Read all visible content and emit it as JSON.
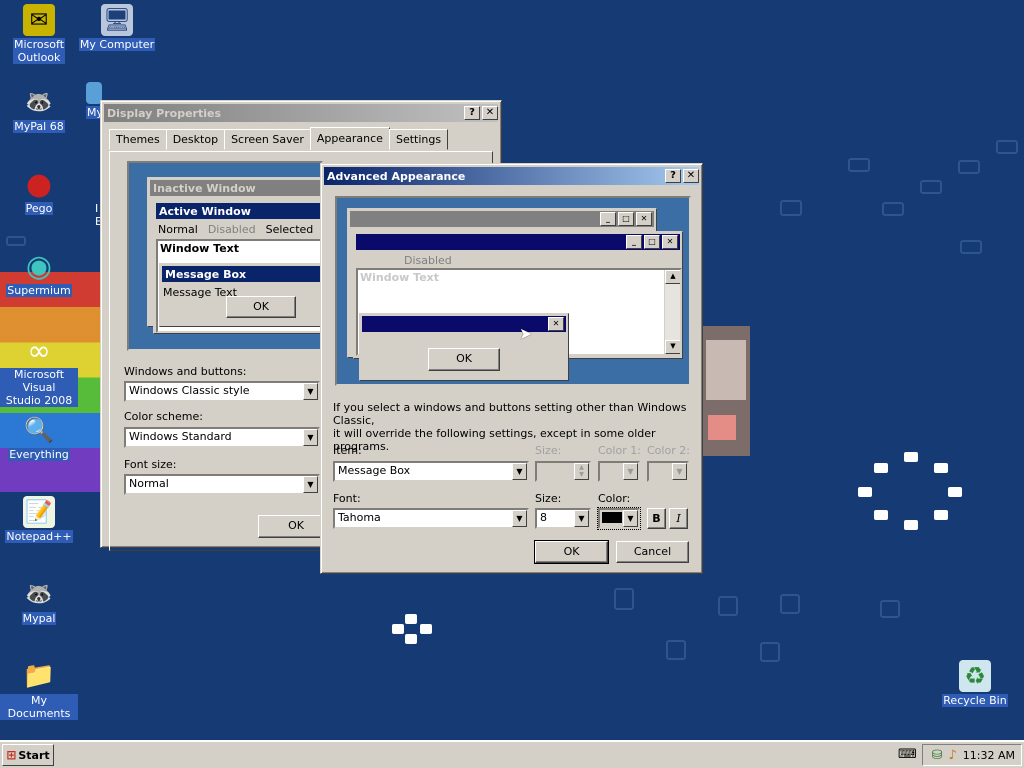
{
  "desktop": {
    "icons": [
      {
        "label": "Microsoft\nOutlook",
        "icon": "outlook-icon",
        "glyph": "✉"
      },
      {
        "label": "My Computer",
        "icon": "my-computer-icon",
        "glyph": "🖥"
      },
      {
        "label": "MyPal 68",
        "icon": "mypal-icon",
        "glyph": "🦝"
      },
      {
        "label": "Pego",
        "icon": "pego-icon",
        "glyph": "●"
      },
      {
        "label": "Supermium",
        "icon": "supermium-icon",
        "glyph": "◉"
      },
      {
        "label": "Microsoft Visual\nStudio 2008",
        "icon": "visual-studio-icon",
        "glyph": "∞"
      },
      {
        "label": "Everything",
        "icon": "everything-icon",
        "glyph": "🔍"
      },
      {
        "label": "Notepad++",
        "icon": "notepadpp-icon",
        "glyph": "📝"
      },
      {
        "label": "Mypal",
        "icon": "mypal-icon",
        "glyph": "🦝"
      },
      {
        "label": "My Documents",
        "icon": "my-documents-icon",
        "glyph": "📁"
      },
      {
        "label": "Recycle Bin",
        "icon": "recycle-bin-icon",
        "glyph": "♻"
      }
    ],
    "partial_labels": {
      "my": "My",
      "i": "I",
      "e": "E"
    }
  },
  "display_properties": {
    "title": "Display Properties",
    "help_btn": "?",
    "close_btn": "✕",
    "tabs": [
      "Themes",
      "Desktop",
      "Screen Saver",
      "Appearance",
      "Settings"
    ],
    "preview": {
      "inactive_window": "Inactive Window",
      "active_window": "Active Window",
      "menu": [
        "Normal",
        "Disabled",
        "Selected"
      ],
      "window_text": "Window Text",
      "message_box": "Message Box",
      "message_text": "Message Text",
      "ok": "OK"
    },
    "windows_and_buttons_label": "Windows and buttons:",
    "windows_and_buttons_value": "Windows Classic style",
    "color_scheme_label": "Color scheme:",
    "color_scheme_value": "Windows Standard",
    "font_size_label": "Font size:",
    "font_size_value": "Normal",
    "ok": "OK"
  },
  "advanced_appearance": {
    "title": "Advanced Appearance",
    "help_btn": "?",
    "close_btn": "✕",
    "preview": {
      "disabled": "Disabled",
      "window_text": "Window Text",
      "ok": "OK"
    },
    "info_text": "If you select a windows and buttons setting other than Windows Classic,\nit will override the following settings, except in some older programs.",
    "item_label": "Item:",
    "item_value": "Message Box",
    "size_label": "Size:",
    "color1_label": "Color 1:",
    "color2_label": "Color 2:",
    "font_label": "Font:",
    "font_value": "Tahoma",
    "font_size_label": "Size:",
    "font_size_value": "8",
    "font_color_label": "Color:",
    "bold": "B",
    "italic": "I",
    "ok": "OK",
    "cancel": "Cancel"
  },
  "taskbar": {
    "start": "Start",
    "clock": "11:32 AM"
  }
}
